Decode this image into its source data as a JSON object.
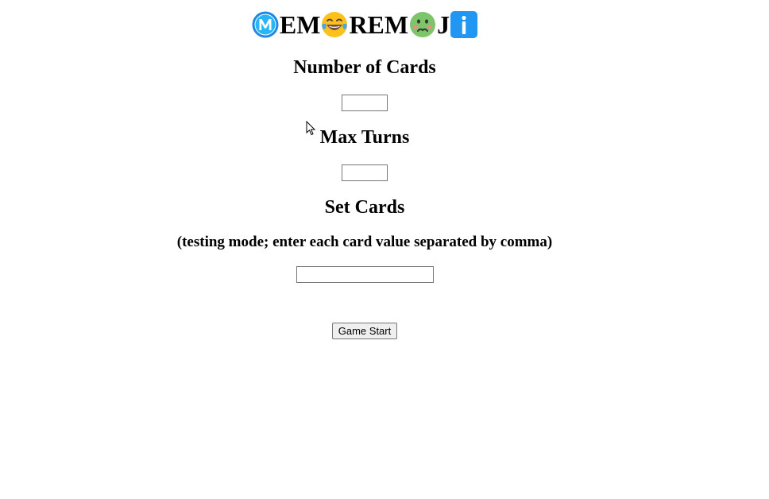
{
  "title": {
    "parts": [
      {
        "kind": "emoji",
        "icon": "circled-m-icon"
      },
      {
        "kind": "text",
        "text": "EM"
      },
      {
        "kind": "emoji",
        "icon": "tears-of-joy-face-icon"
      },
      {
        "kind": "text",
        "text": "REM"
      },
      {
        "kind": "emoji",
        "icon": "nauseated-face-icon"
      },
      {
        "kind": "text",
        "text": "J"
      },
      {
        "kind": "emoji",
        "icon": "information-icon"
      }
    ],
    "text_em": "EM",
    "text_rem": "REM",
    "text_j": "J"
  },
  "number_of_cards": {
    "heading": "Number of Cards",
    "value": "",
    "placeholder": ""
  },
  "max_turns": {
    "heading": "Max Turns",
    "value": "",
    "placeholder": ""
  },
  "set_cards": {
    "heading": "Set Cards",
    "subheading": "(testing mode; enter each card value separated by comma)",
    "value": "",
    "placeholder": ""
  },
  "start_button": {
    "label": "Game Start"
  },
  "colors": {
    "background": "#ffffff",
    "text": "#000000",
    "info_blue": "#1e88e5",
    "circled_m_blue": "#2196f3",
    "emoji_yellow": "#fcc21b",
    "nauseated_green": "#7cc56b"
  }
}
